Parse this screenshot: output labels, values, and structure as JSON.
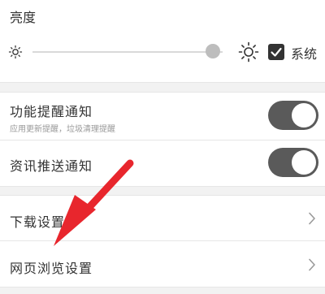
{
  "brightness": {
    "label": "亮度",
    "level": 0.95,
    "system_label": "系统",
    "system_checked": true,
    "low_icon": "sun-small-icon",
    "high_icon": "sun-large-icon"
  },
  "notifications": {
    "feature_reminder": {
      "title": "功能提醒通知",
      "subtitle": "应用更新提醒，垃圾清理提醒",
      "enabled": true
    },
    "news_push": {
      "title": "资讯推送通知",
      "enabled": true
    }
  },
  "settings": {
    "download": {
      "label": "下载设置",
      "icon": "chevron-right-icon"
    },
    "web_browsing": {
      "label": "网页浏览设置",
      "icon": "chevron-right-icon"
    }
  },
  "annotation": {
    "icon": "red-arrow-icon",
    "color": "#e8262d"
  },
  "colors": {
    "toggle_on": "#5a5a5a",
    "section_gap": "#f2f2f2",
    "checkbox": "#333333"
  }
}
